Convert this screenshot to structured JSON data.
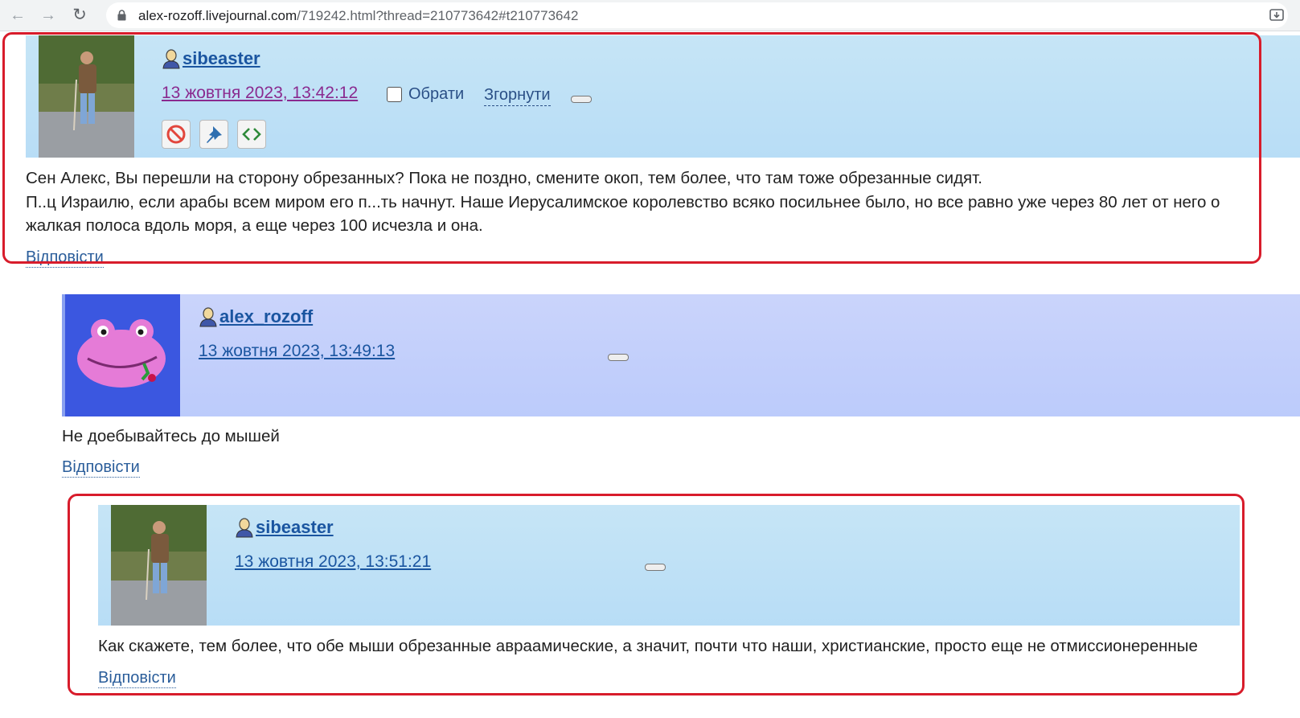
{
  "browser": {
    "url_host": "alex-rozoff.livejournal.com",
    "url_rest": "/719242.html?thread=210773642#t210773642"
  },
  "comments": [
    {
      "username": "sibeaster",
      "datetime": "13 жовтня 2023, 13:42:12",
      "select_label": "Обрати",
      "collapse_label": "Згорнути",
      "text_lines": [
        "Сен Алекс, Вы перешли на сторону обрезанных? Пока не поздно, смените окоп, тем более, что там тоже обрезанные сидят.",
        "П..ц Израилю, если арабы всем миром его п...ть начнут. Наше Иерусалимское королевство всяко посильнее было, но все равно уже через 80 лет от него о",
        "жалкая полоса вдоль моря, а еще через 100 исчезла и она."
      ],
      "reply_label": "Відповісти"
    },
    {
      "username": "alex_rozoff",
      "datetime": "13 жовтня 2023, 13:49:13",
      "text_lines": [
        "Не доебывайтесь до мышей"
      ],
      "reply_label": "Відповісти"
    },
    {
      "username": "sibeaster",
      "datetime": "13 жовтня 2023, 13:51:21",
      "text_lines": [
        "Как скажете, тем более, что обе мыши обрезанные авраамические, а значит, почти что наши, христианские, просто еще не отмиссионеренные"
      ],
      "reply_label": "Відповісти"
    }
  ],
  "colors": {
    "highlight": "#d81c2b",
    "header_blue": "#b8ddf6",
    "header_purple": "#bccbfb",
    "link": "#1a55a0",
    "visited": "#8a2a8f"
  },
  "icons": [
    "back-arrow-icon",
    "forward-arrow-icon",
    "reload-icon",
    "lock-icon",
    "install-icon",
    "user-icon",
    "ban-icon",
    "pin-icon",
    "code-icon"
  ]
}
